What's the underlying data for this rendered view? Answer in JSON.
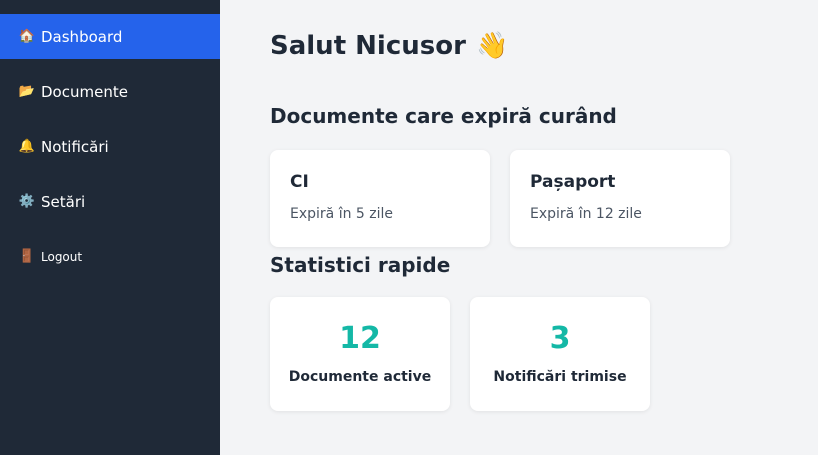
{
  "sidebar": {
    "items": [
      {
        "label": "Dashboard",
        "icon": "🏠"
      },
      {
        "label": "Documente",
        "icon": "📂"
      },
      {
        "label": "Notificări",
        "icon": "🔔"
      },
      {
        "label": "Setări",
        "icon": "⚙️"
      },
      {
        "label": "Logout",
        "icon": "🚪"
      }
    ]
  },
  "main": {
    "greeting": "Salut Nicusor",
    "greeting_emoji": "👋",
    "expiring_title": "Documente care expiră curând",
    "documents": [
      {
        "title": "CI",
        "subtitle": "Expiră în 5 zile"
      },
      {
        "title": "Pașaport",
        "subtitle": "Expiră în 12 zile"
      }
    ],
    "stats_title": "Statistici rapide",
    "stats": [
      {
        "value": "12",
        "label": "Documente active"
      },
      {
        "value": "3",
        "label": "Notificări trimise"
      }
    ]
  },
  "colors": {
    "sidebar_bg": "#1f2937",
    "active_bg": "#2563eb",
    "accent": "#14b8a6",
    "page_bg": "#f3f4f6"
  }
}
